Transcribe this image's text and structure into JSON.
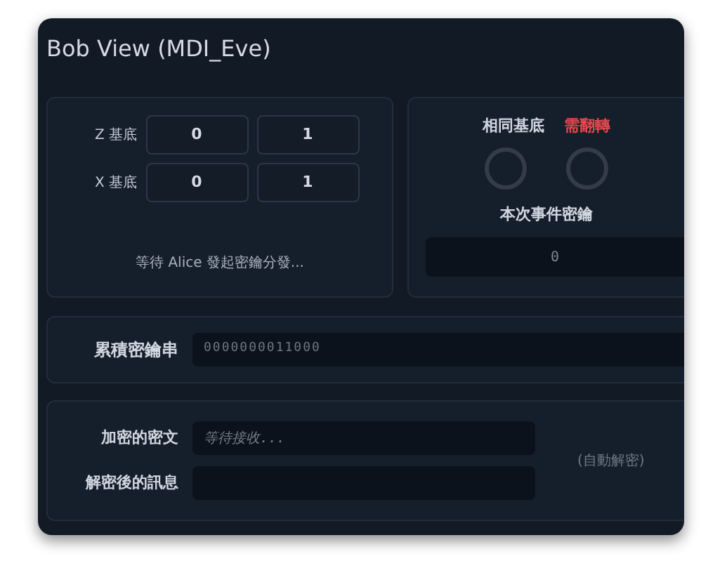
{
  "window": {
    "title": "Bob View (MDI_Eve)"
  },
  "bases": {
    "rows": [
      {
        "label": "Z 基底",
        "values": [
          "0",
          "1"
        ]
      },
      {
        "label": "X 基底",
        "values": [
          "0",
          "1"
        ]
      }
    ],
    "status": "等待 Alice 發起密鑰分發..."
  },
  "result": {
    "same_label": "相同基底",
    "flip_label": "需翻轉",
    "key_label": "本次事件密鑰",
    "key_value": "0"
  },
  "key_string": {
    "label": "累積密鑰串",
    "value": "0000000011000"
  },
  "cipher": {
    "encrypted_label": "加密的密文",
    "encrypted_placeholder": "等待接收...",
    "decrypted_label": "解密後的訊息",
    "note": "(自動解密)"
  }
}
